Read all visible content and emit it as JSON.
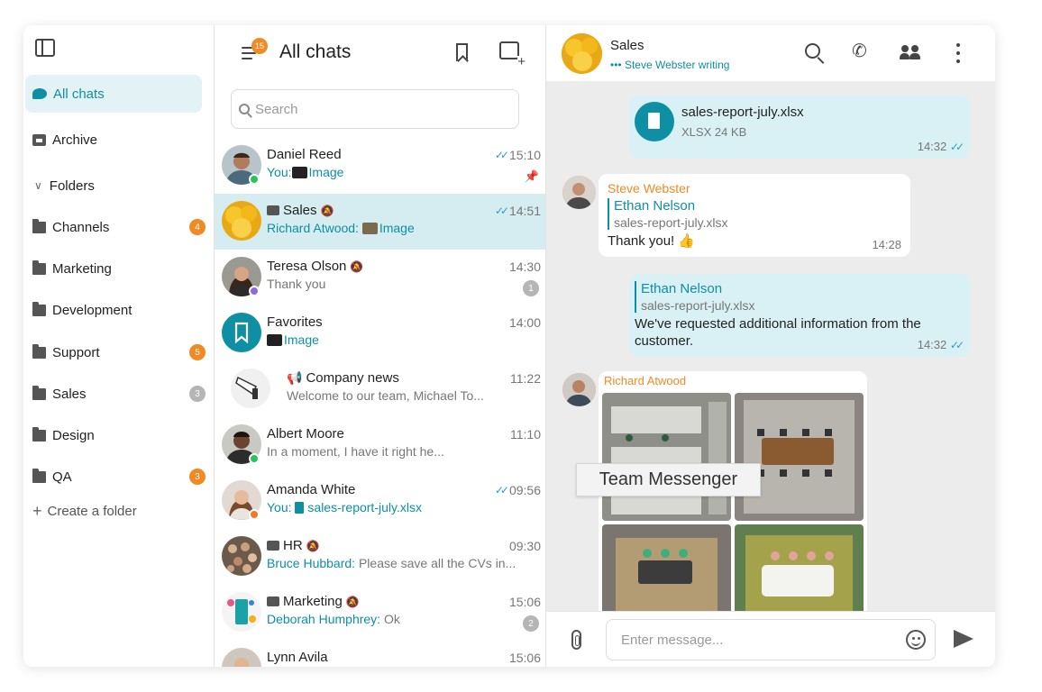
{
  "colors": {
    "accent": "#0e8fa3",
    "badge_orange": "#f08a24",
    "outgoing_bubble": "#d9f1f5",
    "active_row": "#d5ecf1"
  },
  "folders": {
    "items": [
      {
        "label": "All chats",
        "icon": "chat-icon",
        "active": true
      },
      {
        "label": "Archive",
        "icon": "archive-icon"
      },
      {
        "label": "Folders",
        "icon": "chevron-down-icon"
      },
      {
        "label": "Channels",
        "icon": "folder-icon",
        "badge": "4"
      },
      {
        "label": "Marketing",
        "icon": "folder-icon"
      },
      {
        "label": "Development",
        "icon": "folder-icon"
      },
      {
        "label": "Support",
        "icon": "folder-icon",
        "badge": "5"
      },
      {
        "label": "Sales",
        "icon": "folder-icon",
        "badge": "3"
      },
      {
        "label": "Design",
        "icon": "folder-icon"
      },
      {
        "label": "QA",
        "icon": "folder-icon",
        "badge": "3"
      }
    ],
    "create": "Create a folder"
  },
  "chatlist": {
    "menu_count": "15",
    "title": "All chats",
    "search_placeholder": "Search",
    "rows": [
      {
        "name": "Daniel Reed",
        "prefix": "You:",
        "text": "Image",
        "time": "15:10"
      },
      {
        "name": "Sales",
        "prefix": "Richard Atwood:",
        "text": "Image",
        "time": "14:51"
      },
      {
        "name": "Teresa Olson",
        "text": "Thank you",
        "time": "14:30",
        "unread": "1"
      },
      {
        "name": "Favorites",
        "text": "Image",
        "time": "14:00"
      },
      {
        "name": "Company news",
        "text": "Welcome to our team, Michael To...",
        "time": "11:22"
      },
      {
        "name": "Albert Moore",
        "text": "In a moment, I have it right he...",
        "time": "11:10"
      },
      {
        "name": "Amanda White",
        "prefix": "You:",
        "text": "sales-report-july.xlsx",
        "time": "09:56"
      },
      {
        "name": "HR",
        "prefix": "Bruce Hubbard:",
        "text": "Please save all the CVs in...",
        "time": "09:30"
      },
      {
        "name": "Marketing",
        "prefix": "Deborah Humphrey:",
        "text": "Ok",
        "time": "15:06",
        "unread": "2"
      },
      {
        "name": "Lynn Avila",
        "time": "15:06"
      }
    ]
  },
  "conversation": {
    "name": "Sales",
    "status": "Steve Webster writing",
    "file": {
      "name": "sales-report-july.xlsx",
      "size": "XLSX 24 KB",
      "time": "14:32"
    },
    "msg1": {
      "sender": "Steve Webster",
      "quote_name": "Ethan Nelson",
      "quote_file": "sales-report-july.xlsx",
      "text": "Thank you! 👍",
      "time": "14:28"
    },
    "msg2": {
      "quote_name": "Ethan Nelson",
      "quote_file": "sales-report-july.xlsx",
      "text": "We've requested additional information from the customer.",
      "time": "14:32"
    },
    "msg3": {
      "sender": "Richard Atwood"
    },
    "composer_placeholder": "Enter message..."
  },
  "tooltip": "Team Messenger"
}
